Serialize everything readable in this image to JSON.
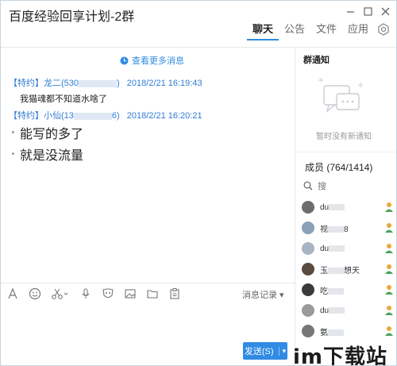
{
  "window": {
    "title": "百度经验回享计划-2群",
    "controls": [
      "minimize",
      "maximize",
      "close"
    ]
  },
  "tabs": [
    {
      "label": "聊天",
      "active": true
    },
    {
      "label": "公告",
      "active": false
    },
    {
      "label": "文件",
      "active": false
    },
    {
      "label": "应用",
      "active": false
    }
  ],
  "chat": {
    "more_messages": "查看更多消息",
    "messages": [
      {
        "tag": "【特约】",
        "sender": "龙二",
        "id_start": "(530",
        "id_end": ")",
        "time": "2018/2/21 16:19:43",
        "body": "我猫魂都不知道水啥了"
      },
      {
        "tag": "【特约】",
        "sender": "小仙",
        "id_start": "(13",
        "id_end": "6)",
        "time": "2018/2/21 16:20:21",
        "lines": [
          "能写的多了",
          "就是没流量"
        ]
      }
    ]
  },
  "toolbar": {
    "icons": [
      "font-icon",
      "emoji-icon",
      "scissors-icon",
      "mic-icon",
      "mask-icon",
      "image-icon",
      "folder-icon",
      "clipboard-icon"
    ],
    "history_label": "消息记录 ▾",
    "send_label": "发送(S)",
    "send_arrow": "▾"
  },
  "sidebar": {
    "notice_title": "群通知",
    "notice_empty": "暂时没有新通知",
    "members_title": "成员 (764/1414)",
    "search_placeholder": "搜",
    "members": [
      {
        "name_start": "du",
        "name_end": "",
        "avatar_color": "#6d6d6d",
        "badge": "admin"
      },
      {
        "name_start": "视",
        "name_end": "8",
        "avatar_color": "#8aa0b8",
        "badge": "member"
      },
      {
        "name_start": "du",
        "name_end": "",
        "avatar_color": "#a7b4c4",
        "badge": "member"
      },
      {
        "name_start": "玉",
        "name_end": "想天",
        "avatar_color": "#5a4a3f",
        "badge": "member"
      },
      {
        "name_start": "吃",
        "name_end": "",
        "avatar_color": "#3b3b3b",
        "badge": "member"
      },
      {
        "name_start": "du",
        "name_end": "",
        "avatar_color": "#9a9a9a",
        "badge": "member"
      },
      {
        "name_start": "氨",
        "name_end": "",
        "avatar_color": "#777777",
        "badge": "member"
      }
    ]
  },
  "watermark": "im下载站",
  "colors": {
    "accent": "#2f8be3",
    "link": "#2f7bd6",
    "badge": "#e8a93a"
  }
}
